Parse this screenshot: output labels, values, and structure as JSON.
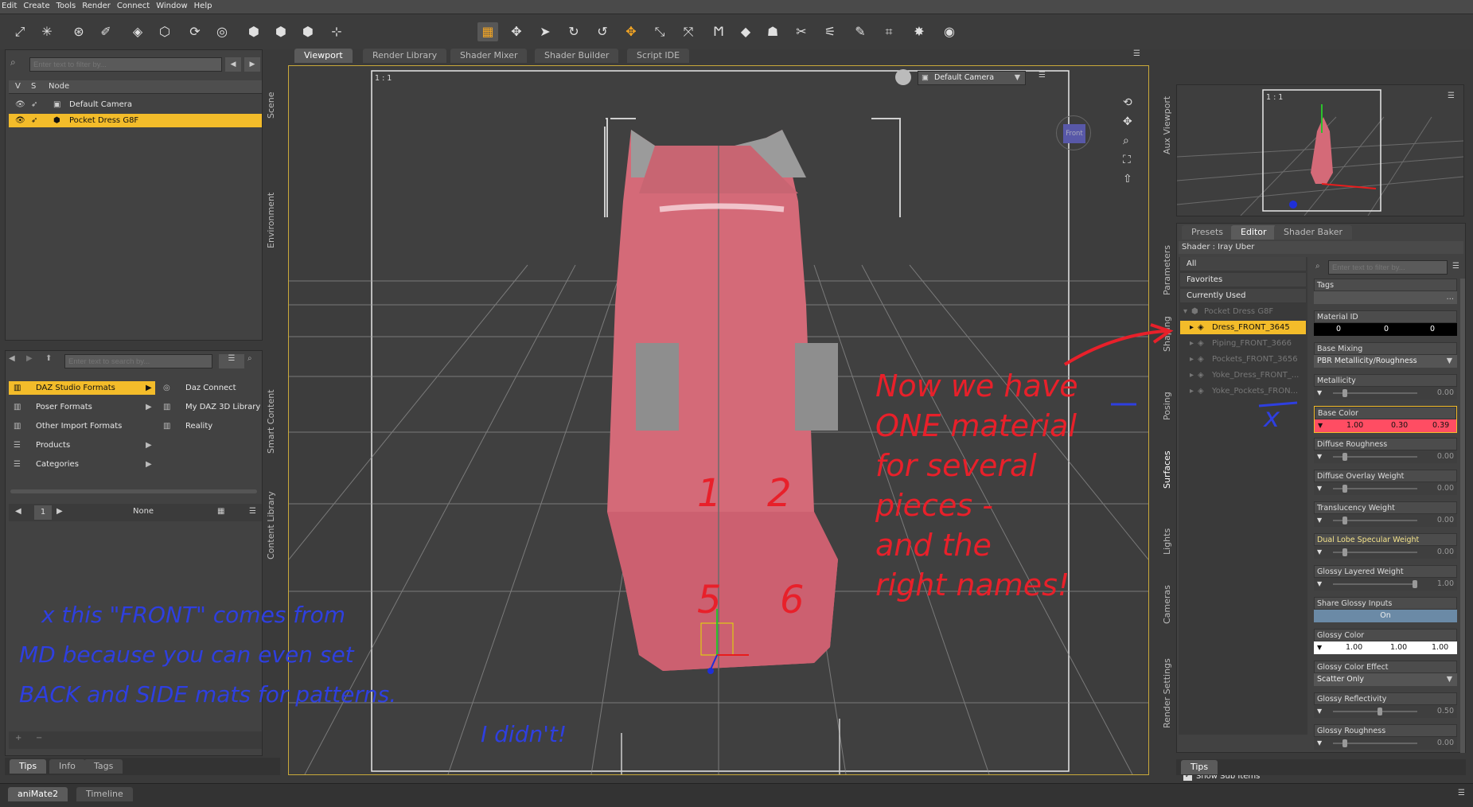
{
  "menu": [
    "Edit",
    "Create",
    "Tools",
    "Render",
    "Connect",
    "Window",
    "Help"
  ],
  "toolbar_icons": [
    "tool-1-icon",
    "tool-2-icon",
    "tool-3-icon",
    "tool-4-icon",
    "tool-5-icon",
    "tool-6-icon",
    "tool-7-icon",
    "tool-8-icon",
    "tool-9-icon",
    "tool-10-icon",
    "tool-11-icon",
    "tool-12-icon"
  ],
  "scene": {
    "filter_placeholder": "Enter text to filter by...",
    "col_v": "V",
    "col_s": "S",
    "col_node": "Node",
    "nodes": [
      {
        "label": "Default Camera"
      },
      {
        "label": "Pocket Dress G8F",
        "selected": true
      }
    ],
    "side_tabs": [
      "Scene",
      "Environment"
    ]
  },
  "content": {
    "search_placeholder": "Enter text to search by...",
    "left_items": [
      "DAZ Studio Formats",
      "Poser Formats",
      "Other Import Formats",
      "Products",
      "Categories"
    ],
    "right_items": [
      "Daz Connect",
      "My DAZ 3D Library",
      "Reality"
    ],
    "page": "1",
    "sort": "None",
    "side_tabs": [
      "Smart Content",
      "Content Library"
    ],
    "bottom_tabs": [
      "Tips",
      "Info",
      "Tags"
    ]
  },
  "viewport": {
    "tabs": [
      "Viewport",
      "Render Library",
      "Shader Mixer",
      "Shader Builder",
      "Script IDE"
    ],
    "ratio": "1 : 1",
    "camera": "Default Camera",
    "cube_label": "Front"
  },
  "aux": {
    "side_tab": "Aux Viewport",
    "ratio": "1 : 1"
  },
  "surfaces": {
    "tabs": [
      "Presets",
      "Editor",
      "Shader Baker"
    ],
    "shader": "Shader : Iray Uber",
    "filters": [
      "All",
      "Favorites",
      "Currently Used"
    ],
    "tree_root": "Pocket Dress G8F",
    "tree_items": [
      {
        "label": "Dress_FRONT_3645",
        "selected": true
      },
      {
        "label": "Piping_FRONT_3666"
      },
      {
        "label": "Pockets_FRONT_3656"
      },
      {
        "label": "Yoke_Dress_FRONT_..."
      },
      {
        "label": "Yoke_Pockets_FRON..."
      }
    ],
    "show_sub": "Show Sub Items",
    "filter_placeholder": "Enter text to filter by...",
    "side_tabs": [
      "Parameters",
      "Shaping",
      "Posing",
      "Surfaces",
      "Lights",
      "Cameras",
      "Render Settings"
    ],
    "bottom_tab": "Tips"
  },
  "props": {
    "tags": "Tags",
    "material_id": {
      "label": "Material ID",
      "values": [
        "0",
        "0",
        "0"
      ]
    },
    "base_mixing": {
      "label": "Base Mixing",
      "value": "PBR Metallicity/Roughness"
    },
    "metallicity": {
      "label": "Metallicity",
      "value": "0.00"
    },
    "base_color": {
      "label": "Base Color",
      "values": [
        "1.00",
        "0.30",
        "0.39"
      ],
      "color": "#ff4d63"
    },
    "diffuse_roughness": {
      "label": "Diffuse Roughness",
      "value": "0.00"
    },
    "diffuse_overlay": {
      "label": "Diffuse Overlay Weight",
      "value": "0.00"
    },
    "translucency": {
      "label": "Translucency Weight",
      "value": "0.00"
    },
    "dual_lobe": {
      "label": "Dual Lobe Specular Weight",
      "value": "0.00"
    },
    "glossy_layered": {
      "label": "Glossy Layered Weight",
      "value": "1.00"
    },
    "share_glossy": {
      "label": "Share Glossy Inputs",
      "value": "On"
    },
    "glossy_color": {
      "label": "Glossy Color",
      "values": [
        "1.00",
        "1.00",
        "1.00"
      ]
    },
    "glossy_effect": {
      "label": "Glossy Color Effect",
      "value": "Scatter Only"
    },
    "glossy_reflectivity": {
      "label": "Glossy Reflectivity",
      "value": "0.50"
    },
    "glossy_roughness": {
      "label": "Glossy Roughness",
      "value": "0.00"
    }
  },
  "bottom_tabs": [
    "aniMate2",
    "Timeline"
  ],
  "annotations": {
    "red": [
      "Now we have",
      "ONE material",
      "for several",
      "pieces -",
      "and the",
      "right names!"
    ],
    "blue": [
      "x this \"FRONT\" comes from",
      "MD because you can even set",
      "BACK and SIDE mats for patterns.",
      "I didn't!"
    ],
    "numbers": [
      "1",
      "2",
      "5",
      "6"
    ],
    "blue_x": "x"
  },
  "colors": {
    "accent": "#f3bc2a",
    "red_ink": "#e8202a",
    "blue_ink": "#2e3fe0",
    "dress": "#d46a78"
  }
}
